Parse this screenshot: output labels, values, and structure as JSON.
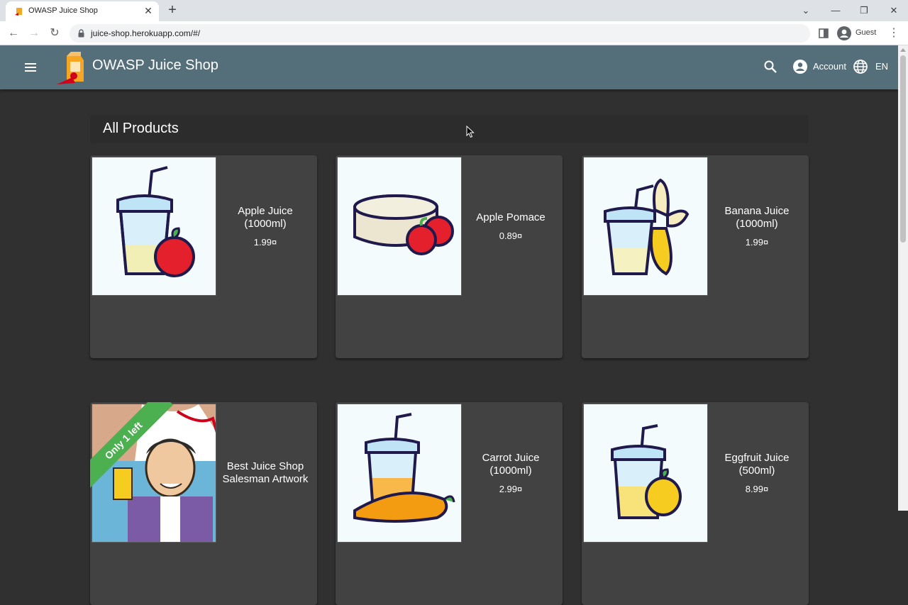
{
  "browser": {
    "tab_title": "OWASP Juice Shop",
    "tab_close": "✕",
    "new_tab": "+",
    "url": "juice-shop.herokuapp.com/#/",
    "profile_label": "Guest",
    "icons": {
      "favicon": "juice-shop-favicon-icon",
      "back": "back-arrow-icon",
      "forward": "forward-arrow-icon",
      "reload": "reload-icon",
      "lock": "lock-icon",
      "side_panel": "side-panel-icon",
      "profile": "profile-icon",
      "menu": "kebab-menu-icon"
    },
    "glyphs": {
      "back": "←",
      "forward": "→",
      "reload": "↻",
      "tab_list": "⌄",
      "minimize": "—",
      "maximize": "❐",
      "close": "✕",
      "kebab": "⋮"
    }
  },
  "app": {
    "title": "OWASP Juice Shop",
    "account_label": "Account",
    "language_label": "EN",
    "toolbar_color": "#546e7a",
    "accent_color": "#4caf50"
  },
  "main": {
    "heading": "All Products",
    "products": [
      {
        "name": "Apple Juice (1000ml)",
        "price": "1.99¤",
        "icon": "apple-juice-icon"
      },
      {
        "name": "Apple Pomace",
        "price": "0.89¤",
        "icon": "apple-pomace-icon"
      },
      {
        "name": "Banana Juice (1000ml)",
        "price": "1.99¤",
        "icon": "banana-juice-icon"
      },
      {
        "name": "Best Juice Shop Salesman Artwork",
        "price": "",
        "icon": "salesman-artwork-image",
        "ribbon": "Only 1 left"
      },
      {
        "name": "Carrot Juice (1000ml)",
        "price": "2.99¤",
        "icon": "carrot-juice-icon"
      },
      {
        "name": "Eggfruit Juice (500ml)",
        "price": "8.99¤",
        "icon": "eggfruit-juice-icon"
      }
    ]
  }
}
